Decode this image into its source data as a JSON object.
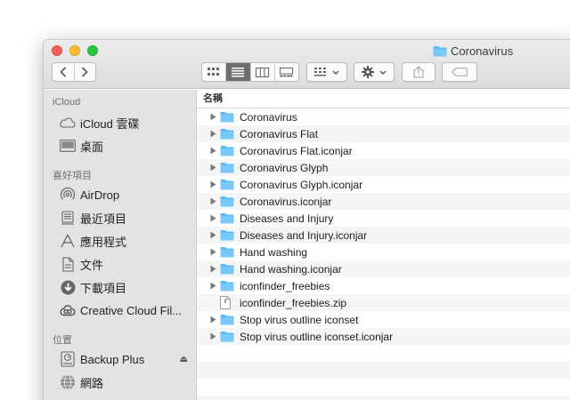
{
  "window": {
    "title": "Coronavirus",
    "traffic_lights": [
      "close",
      "minimize",
      "zoom"
    ]
  },
  "toolbar": {
    "back_icon": "chevron-left-icon",
    "forward_icon": "chevron-right-icon",
    "views": [
      "icon-view",
      "list-view",
      "column-view",
      "gallery-view"
    ],
    "active_view": "list-view",
    "group_icon": "group-icon",
    "action_icon": "gear-icon",
    "share_icon": "share-icon",
    "tag_icon": "tag-icon"
  },
  "sidebar": {
    "sections": [
      {
        "header": "iCloud",
        "items": [
          {
            "label": "iCloud 雲碟",
            "icon": "cloud-icon"
          },
          {
            "label": "桌面",
            "icon": "desktop-icon"
          }
        ]
      },
      {
        "header": "喜好項目",
        "items": [
          {
            "label": "AirDrop",
            "icon": "airdrop-icon"
          },
          {
            "label": "最近項目",
            "icon": "recents-icon"
          },
          {
            "label": "應用程式",
            "icon": "applications-icon"
          },
          {
            "label": "文件",
            "icon": "documents-icon"
          },
          {
            "label": "下載項目",
            "icon": "downloads-icon"
          },
          {
            "label": "Creative Cloud Fil...",
            "icon": "creative-cloud-icon"
          }
        ]
      },
      {
        "header": "位置",
        "items": [
          {
            "label": "Backup Plus",
            "icon": "drive-icon",
            "eject": "⏏"
          },
          {
            "label": "網路",
            "icon": "network-icon"
          }
        ]
      }
    ]
  },
  "list": {
    "column_header": "名稱",
    "rows": [
      {
        "name": "Coronavirus",
        "type": "folder"
      },
      {
        "name": "Coronavirus Flat",
        "type": "folder"
      },
      {
        "name": "Coronavirus Flat.iconjar",
        "type": "folder"
      },
      {
        "name": "Coronavirus Glyph",
        "type": "folder"
      },
      {
        "name": "Coronavirus Glyph.iconjar",
        "type": "folder"
      },
      {
        "name": "Coronavirus.iconjar",
        "type": "folder"
      },
      {
        "name": "Diseases and Injury",
        "type": "folder"
      },
      {
        "name": "Diseases and Injury.iconjar",
        "type": "folder"
      },
      {
        "name": "Hand washing",
        "type": "folder"
      },
      {
        "name": "Hand washing.iconjar",
        "type": "folder"
      },
      {
        "name": "iconfinder_freebies",
        "type": "folder"
      },
      {
        "name": "iconfinder_freebies.zip",
        "type": "file"
      },
      {
        "name": "Stop virus outline iconset",
        "type": "folder"
      },
      {
        "name": "Stop virus outline iconset.iconjar",
        "type": "folder"
      }
    ]
  },
  "colors": {
    "folder": "#5db8f5",
    "sidebar_bg": "#e3e3e3",
    "alt_row": "#f4f5f5"
  }
}
